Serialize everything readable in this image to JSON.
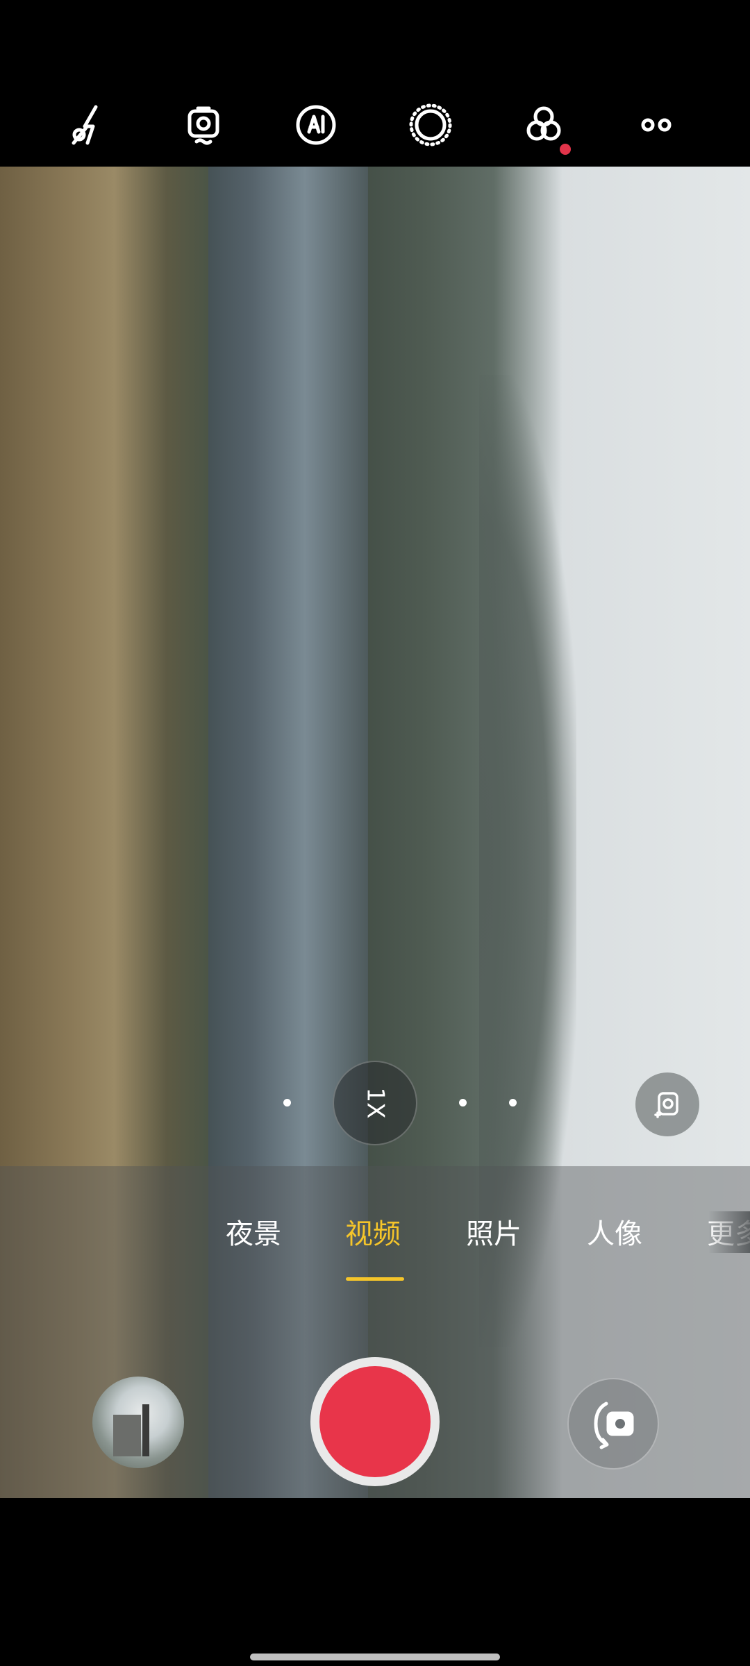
{
  "top_toolbar": {
    "icons": [
      "flash-off-icon",
      "video-stabilization-icon",
      "ai-scene-icon",
      "settings-ring-icon",
      "filters-icon",
      "more-icon"
    ],
    "notification_dot_color": "#e2344a"
  },
  "viewfinder": {
    "zoom_label": "1X"
  },
  "mode_selector": {
    "modes": [
      {
        "label": "夜景",
        "active": false
      },
      {
        "label": "视频",
        "active": true
      },
      {
        "label": "照片",
        "active": false
      },
      {
        "label": "人像",
        "active": false
      },
      {
        "label": "更多",
        "active": false
      }
    ],
    "active_color": "#f5c52a"
  },
  "controls": {
    "shutter_color": "#e8354a"
  }
}
